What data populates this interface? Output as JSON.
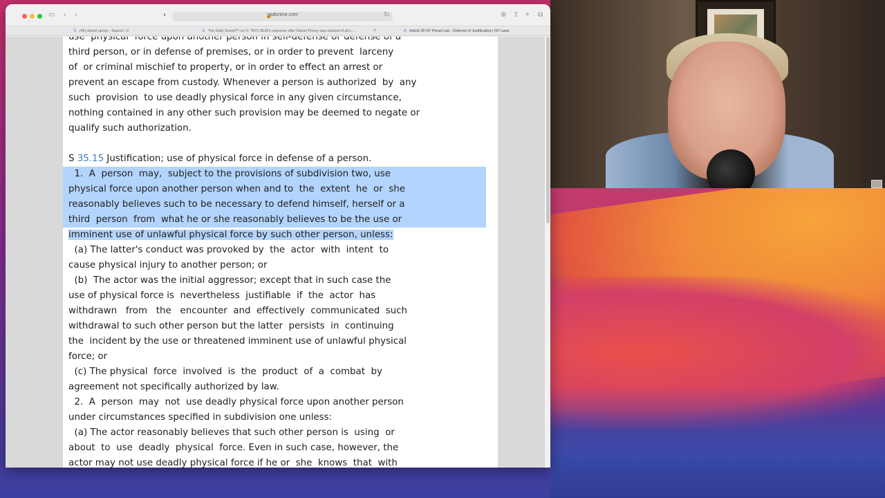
{
  "browser": {
    "address": "ypdcrime.com",
    "tabs": [
      {
        "label": "(45) daniel penny - Search / X",
        "active": false
      },
      {
        "label": "The Daily Sneed™ on X: \"NYC BLM's response after Daniel Penny was cleared of all c...",
        "active": false
      },
      {
        "label": "Article 35 NY Penal Law - Defense of Justification | NY Laws",
        "active": true
      }
    ]
  },
  "document": {
    "lines": [
      "use  physical  force upon another person in self-defense or defense of a",
      "third person, or in defense of premises, or in order to prevent  larceny",
      "of  or criminal mischief to property, or in order to effect an arrest or",
      "prevent an escape from custody. Whenever a person is authorized  by  any",
      "such  provision  to use deadly physical force in any given circumstance,",
      "nothing contained in any other such provision may be deemed to negate or",
      "qualify such authorization.",
      "",
      "",
      "  1.  A  person  may,  subject to the provisions of subdivision two, use",
      "physical force upon another person when and to  the  extent  he  or  she",
      "reasonably believes such to be necessary to defend himself, herself or a",
      "third  person  from  what he or she reasonably believes to be the use or",
      "imminent use of unlawful physical force by such other person, unless:",
      "  (a) The latter's conduct was provoked by  the  actor  with  intent  to",
      "cause physical injury to another person; or",
      "  (b)  The actor was the initial aggressor; except that in such case the",
      "use of physical force is  nevertheless  justifiable  if  the  actor  has",
      "withdrawn   from   the   encounter  and  effectively  communicated  such",
      "withdrawal to such other person but the latter  persists  in  continuing",
      "the  incident by the use or threatened imminent use of unlawful physical",
      "force; or",
      "  (c) The physical  force  involved  is  the  product  of  a  combat  by",
      "agreement not specifically authorized by law.",
      "  2.  A  person  may  not  use deadly physical force upon another person",
      "under circumstances specified in subdivision one unless:",
      "  (a) The actor reasonably believes that such other person is  using  or",
      "about  to  use  deadly  physical  force. Even in such case, however, the",
      "actor may not use deadly physical force if he or  she  knows  that  with"
    ],
    "section_prefix": "S ",
    "section_link": "35.15",
    "section_title": " Justification; use of physical force in defense of a person."
  }
}
